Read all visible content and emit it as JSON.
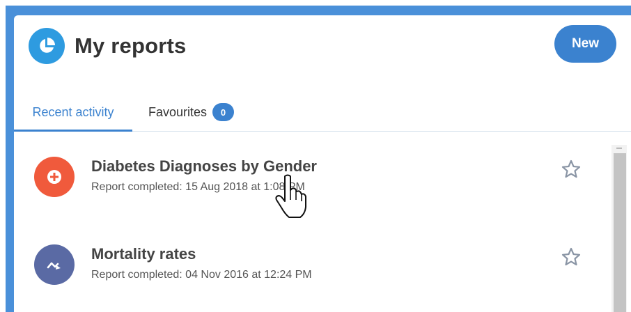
{
  "header": {
    "title": "My reports",
    "logo_icon": "pie-chart-icon",
    "new_button_label": "New"
  },
  "tabs": [
    {
      "label": "Recent activity",
      "active": true
    },
    {
      "label": "Favourites",
      "active": false,
      "count": "0"
    }
  ],
  "reports": [
    {
      "name": "Diabetes Diagnoses by Gender",
      "status": "Report completed: 15 Aug 2018 at 1:08 PM",
      "icon": "plus-circle-icon",
      "icon_color": "#f05a3c",
      "favourite": false
    },
    {
      "name": "Mortality rates",
      "status": "Report completed: 04 Nov 2016 at 12:24 PM",
      "icon": "trend-line-icon",
      "icon_color": "#5a6aa4",
      "favourite": false
    }
  ],
  "colors": {
    "accent": "#3b82cf",
    "frame": "#4a90d9",
    "logo": "#2e9be0",
    "star": "#8a95a5"
  }
}
